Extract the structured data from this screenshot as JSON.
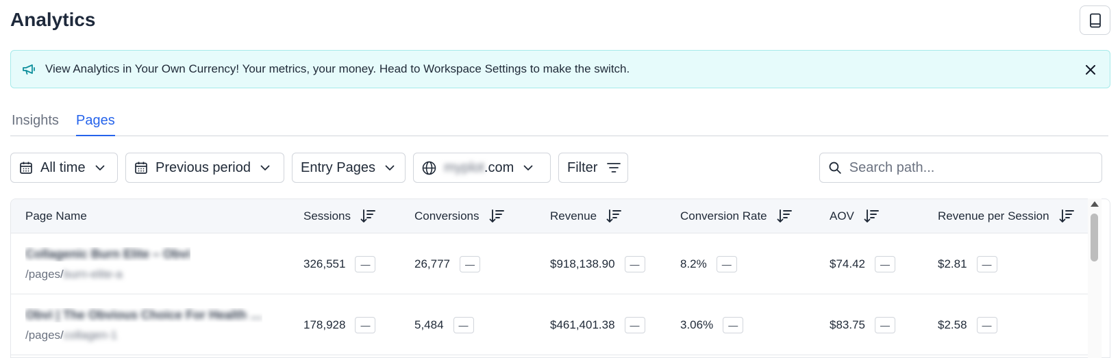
{
  "page": {
    "title": "Analytics"
  },
  "banner": {
    "icon": "megaphone-icon",
    "text": "View Analytics in Your Own Currency! Your metrics, your money. Head to Workspace Settings to make the switch."
  },
  "tabs": [
    {
      "label": "Insights",
      "active": false
    },
    {
      "label": "Pages",
      "active": true
    }
  ],
  "controls": {
    "date_range": "All time",
    "comparison": "Previous period",
    "page_type": "Entry Pages",
    "domain_blurred": "myplot",
    "domain_suffix": ".com",
    "filter": "Filter",
    "search_placeholder": "Search path..."
  },
  "table": {
    "columns": [
      "Page Name",
      "Sessions",
      "Conversions",
      "Revenue",
      "Conversion Rate",
      "AOV",
      "Revenue per Session"
    ],
    "delta_symbol": "—",
    "rows": [
      {
        "name": "Collagenic Burn Elite – Obvi",
        "path_prefix": "/pages/",
        "path_blurred": "burn-elite-a",
        "sessions": "326,551",
        "conversions": "26,777",
        "revenue": "$918,138.90",
        "conversion_rate": "8.2%",
        "aov": "$74.42",
        "revenue_per_session": "$2.81"
      },
      {
        "name": "Obvi | The Obvious Choice For Health …",
        "path_prefix": "/pages/",
        "path_blurred": "collagen-1",
        "sessions": "178,928",
        "conversions": "5,484",
        "revenue": "$461,401.38",
        "conversion_rate": "3.06%",
        "aov": "$83.75",
        "revenue_per_session": "$2.58"
      }
    ]
  }
}
